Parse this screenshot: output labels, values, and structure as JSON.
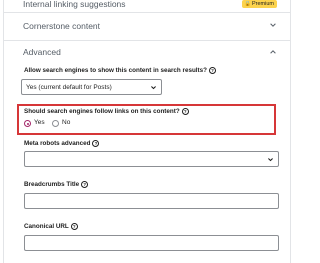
{
  "sections": {
    "internal_linking": {
      "label": "Internal linking suggestions",
      "badge": "Premium"
    },
    "cornerstone": {
      "label": "Cornerstone content"
    },
    "advanced": {
      "label": "Advanced"
    }
  },
  "advanced": {
    "allow_search": {
      "label": "Allow search engines to show this content in search results?",
      "help_icon": "?",
      "selected": "Yes (current default for Posts)"
    },
    "follow_links": {
      "label": "Should search engines follow links on this content?",
      "help_icon": "?",
      "options": [
        "Yes",
        "No"
      ],
      "selected": "Yes"
    },
    "meta_robots": {
      "label": "Meta robots advanced",
      "help_icon": "?",
      "value": ""
    },
    "breadcrumbs_title": {
      "label": "Breadcrumbs Title",
      "help_icon": "?",
      "value": ""
    },
    "canonical_url": {
      "label": "Canonical URL",
      "help_icon": "?",
      "value": ""
    }
  },
  "colors": {
    "highlight": "#d63638",
    "radio_accent": "#a4286a",
    "premium_badge": "#fcd34d",
    "border": "#e2e4e7"
  },
  "icons": {
    "lock": "lock-icon",
    "chevron_down": "chevron-down-icon",
    "chevron_up": "chevron-up-icon",
    "help": "help-icon"
  }
}
